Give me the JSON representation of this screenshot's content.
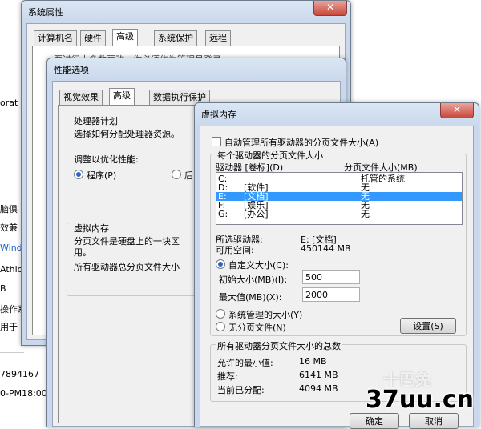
{
  "background": {
    "left_texts": [
      "orat",
      "脑俱",
      "效兼",
      "Wind",
      "Athlo",
      "B",
      "操作系",
      "用于",
      "7894167",
      "0-PM18:00"
    ]
  },
  "sys_props": {
    "title": "系统属性",
    "close": "✕",
    "tabs": [
      "计算机名",
      "硬件",
      "高级",
      "系统保护",
      "远程"
    ],
    "obscured_text": "要进行大多数更改，你必须作为管理员登录"
  },
  "perf": {
    "title": "性能选项",
    "tabs": [
      "视觉效果",
      "高级",
      "数据执行保护"
    ],
    "cpu_group": "处理器计划",
    "cpu_desc": "选择如何分配处理器资源。",
    "optimize_label": "调整以优化性能:",
    "opt_program": "程序(P)",
    "opt_service_partial": "后",
    "vm_group": "虚拟内存",
    "vm_desc_1": "分页文件是硬盘上的一块区",
    "vm_desc_2": "用。",
    "vm_total": "所有驱动器总分页文件大小"
  },
  "vm": {
    "title": "虚拟内存",
    "close": "✕",
    "auto_manage": "自动管理所有驱动器的分页文件大小(A)",
    "each_drive_group": "每个驱动器的分页文件大小",
    "col_drive": "驱动器 [卷标](D)",
    "col_size": "分页文件大小(MB)",
    "drives": [
      {
        "drive": "C:",
        "label": "",
        "size": "托管的系统"
      },
      {
        "drive": "D:",
        "label": "[软件]",
        "size": "无"
      },
      {
        "drive": "E:",
        "label": "[文档]",
        "size": "无"
      },
      {
        "drive": "F:",
        "label": "[娱乐]",
        "size": "无"
      },
      {
        "drive": "G:",
        "label": "[办公]",
        "size": "无"
      }
    ],
    "selected_drive_label": "所选驱动器:",
    "selected_drive_value": "E: [文档]",
    "free_space_label": "可用空间:",
    "free_space_value": "450144 MB",
    "custom_size": "自定义大小(C):",
    "initial_label": "初始大小(MB)(I):",
    "initial_value": "500",
    "max_label": "最大值(MB)(X):",
    "max_value": "2000",
    "system_managed": "系统管理的大小(Y)",
    "no_paging": "无分页文件(N)",
    "set_button": "设置(S)",
    "total_group": "所有驱动器分页文件大小的总数",
    "min_allowed_label": "允许的最小值:",
    "min_allowed_value": "16 MB",
    "recommended_label": "推荐:",
    "recommended_value": "6141 MB",
    "allocated_label": "当前已分配:",
    "allocated_value": "4094 MB",
    "ok_button": "确定",
    "cancel_button": "取消"
  },
  "watermark": {
    "top": "十巴免",
    "main": "37uu.cn"
  }
}
